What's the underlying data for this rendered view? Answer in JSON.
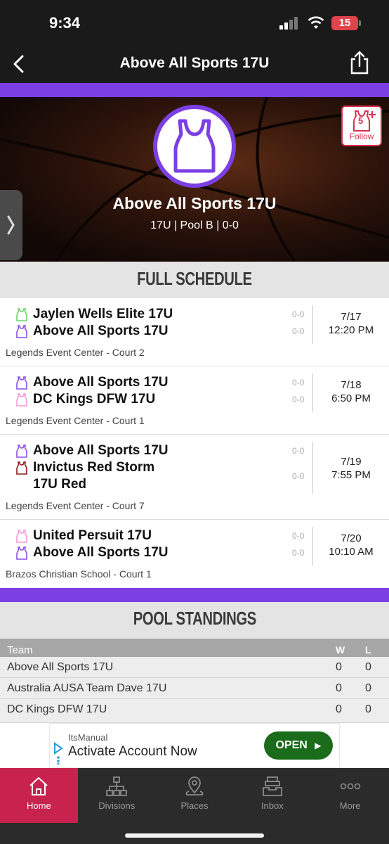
{
  "status_bar": {
    "time": "9:34",
    "battery": "15"
  },
  "nav": {
    "title": "Above All Sports 17U"
  },
  "hero": {
    "team_name": "Above All Sports 17U",
    "subtitle": "17U | Pool B | 0-0",
    "follow_count": "5",
    "follow_label": "Follow",
    "accent_color": "#7b3fe4"
  },
  "schedule": {
    "title": "FULL SCHEDULE",
    "games": [
      {
        "teams": [
          {
            "name": "Jaylen Wells Elite 17U",
            "score": "0-0",
            "jersey_color": "#6fd46f"
          },
          {
            "name": "Above All Sports 17U",
            "score": "0-0",
            "jersey_color": "#8a4fe8"
          }
        ],
        "date": "7/17",
        "time": "12:20 PM",
        "venue": "Legends Event Center - Court 2"
      },
      {
        "teams": [
          {
            "name": "Above All Sports 17U",
            "score": "0-0",
            "jersey_color": "#8a4fe8"
          },
          {
            "name": "DC Kings DFW 17U",
            "score": "0-0",
            "jersey_color": "#f49ad8"
          }
        ],
        "date": "7/18",
        "time": "6:50 PM",
        "venue": "Legends Event Center - Court 1"
      },
      {
        "teams": [
          {
            "name": "Above All Sports 17U",
            "score": "0-0",
            "jersey_color": "#8a4fe8"
          },
          {
            "name_line1": "Invictus Red Storm",
            "name_line2": "17U Red",
            "score": "0-0",
            "jersey_color": "#8b1a1a"
          }
        ],
        "date": "7/19",
        "time": "7:55 PM",
        "venue": "Legends Event Center - Court 7"
      },
      {
        "teams": [
          {
            "name": "United Persuit 17U",
            "score": "0-0",
            "jersey_color": "#f49ad8"
          },
          {
            "name": "Above All Sports 17U",
            "score": "0-0",
            "jersey_color": "#8a4fe8"
          }
        ],
        "date": "7/20",
        "time": "10:10 AM",
        "venue": "Brazos Christian School - Court 1"
      }
    ]
  },
  "standings": {
    "title": "POOL STANDINGS",
    "columns": {
      "team": "Team",
      "w": "W",
      "l": "L"
    },
    "rows": [
      {
        "team": "Above All Sports 17U",
        "w": "0",
        "l": "0"
      },
      {
        "team": "Australia AUSA Team Dave 17U",
        "w": "0",
        "l": "0"
      },
      {
        "team": "DC Kings DFW 17U",
        "w": "0",
        "l": "0"
      }
    ]
  },
  "ad": {
    "brand": "ItsManual",
    "title": "Activate Account Now",
    "cta": "OPEN"
  },
  "tabs": [
    {
      "label": "Home",
      "icon": "home-icon",
      "active": true
    },
    {
      "label": "Divisions",
      "icon": "divisions-icon"
    },
    {
      "label": "Places",
      "icon": "map-pin-icon"
    },
    {
      "label": "Inbox",
      "icon": "inbox-icon"
    },
    {
      "label": "More",
      "icon": "more-icon"
    }
  ]
}
